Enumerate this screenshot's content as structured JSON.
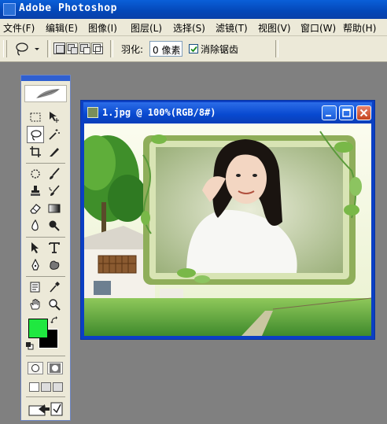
{
  "window": {
    "title": "Adobe Photoshop",
    "app_icon": "photoshop-app-icon"
  },
  "menu": [
    {
      "id": "file",
      "label": "文件(F)"
    },
    {
      "id": "edit",
      "label": "编辑(E)"
    },
    {
      "id": "image",
      "label": "图像(I)"
    },
    {
      "id": "layer",
      "label": "图层(L)"
    },
    {
      "id": "select",
      "label": "选择(S)"
    },
    {
      "id": "filter",
      "label": "滤镜(T)"
    },
    {
      "id": "view",
      "label": "视图(V)"
    },
    {
      "id": "window",
      "label": "窗口(W)"
    },
    {
      "id": "help",
      "label": "帮助(H)"
    }
  ],
  "options_bar": {
    "active_tool_icon": "lasso-icon",
    "selection_modes": [
      "new-selection",
      "add-to-selection",
      "subtract-from-selection",
      "intersect-selection"
    ],
    "active_mode": "new-selection",
    "feather_label": "羽化:",
    "feather_value": "0 像素",
    "antialias_label": "消除锯齿",
    "antialias_checked": true
  },
  "toolbox": {
    "active_tool": "lasso",
    "tools": [
      "rectangular-marquee",
      "move",
      "lasso",
      "magic-wand",
      "crop",
      "slice",
      "healing-brush",
      "brush",
      "clone-stamp",
      "history-brush",
      "eraser",
      "gradient",
      "blur",
      "dodge",
      "path-selection",
      "type",
      "pen",
      "custom-shape",
      "notes",
      "eyedropper",
      "hand",
      "zoom"
    ],
    "foreground_color": "#1fe840",
    "background_color": "#000000"
  },
  "document": {
    "title": "1.jpg @ 100%(RGB/8#)",
    "controls": [
      "minimize",
      "maximize",
      "close"
    ]
  },
  "colors": {
    "titlebar": "#0447b8",
    "chrome": "#ece9d8",
    "workspace": "#808080",
    "foreground": "#1fe840"
  }
}
